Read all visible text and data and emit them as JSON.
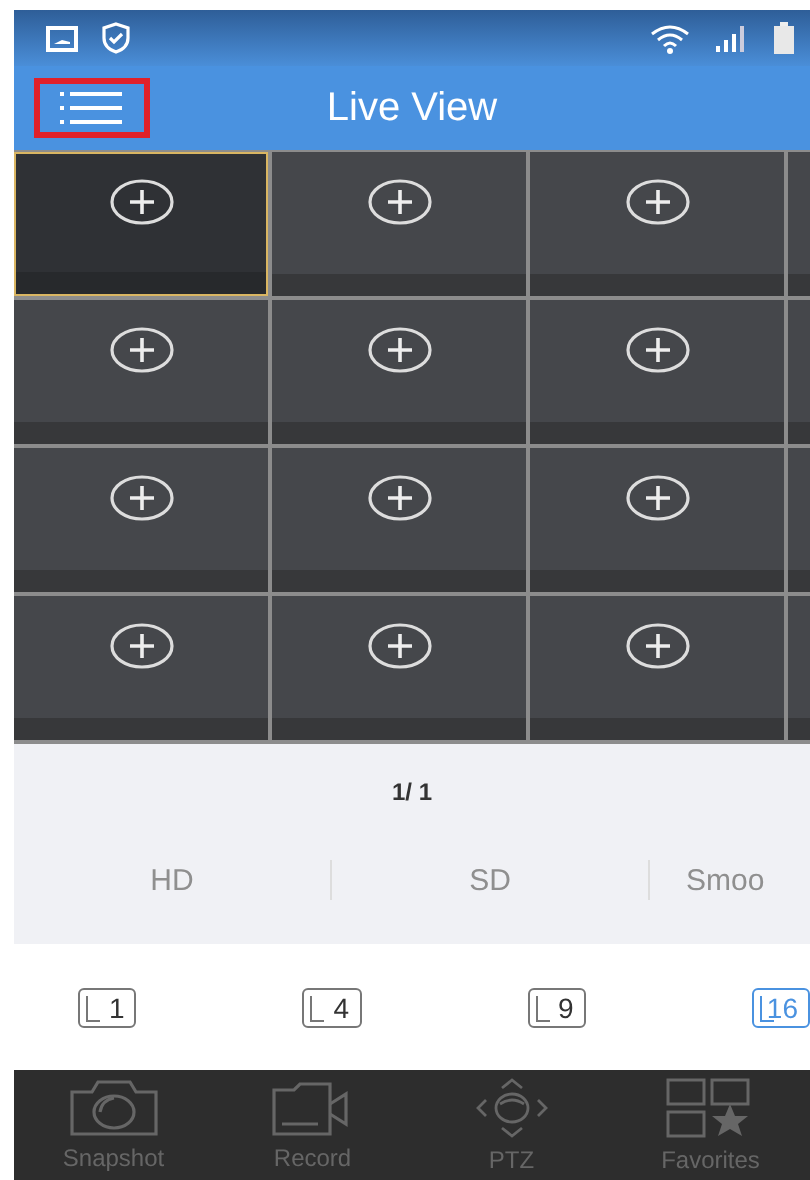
{
  "header": {
    "title": "Live View",
    "menu_highlighted": true
  },
  "cells": [
    {
      "selected": true
    },
    {
      "selected": false
    },
    {
      "selected": false
    },
    {
      "selected": false
    },
    {
      "selected": false
    },
    {
      "selected": false
    },
    {
      "selected": false
    },
    {
      "selected": false
    },
    {
      "selected": false
    },
    {
      "selected": false
    },
    {
      "selected": false
    },
    {
      "selected": false
    },
    {
      "selected": false
    },
    {
      "selected": false
    },
    {
      "selected": false
    },
    {
      "selected": false
    }
  ],
  "page_indicator": "1/ 1",
  "quality_options": [
    "HD",
    "SD",
    "Smoo"
  ],
  "layouts": [
    {
      "label": "1",
      "selected": false
    },
    {
      "label": "4",
      "selected": false
    },
    {
      "label": "9",
      "selected": false
    },
    {
      "label": "16",
      "selected": true
    }
  ],
  "toolbar": [
    {
      "kind": "snapshot",
      "label": "Snapshot"
    },
    {
      "kind": "record",
      "label": "Record"
    },
    {
      "kind": "ptz",
      "label": "PTZ"
    },
    {
      "kind": "favorites",
      "label": "Favorites"
    }
  ]
}
